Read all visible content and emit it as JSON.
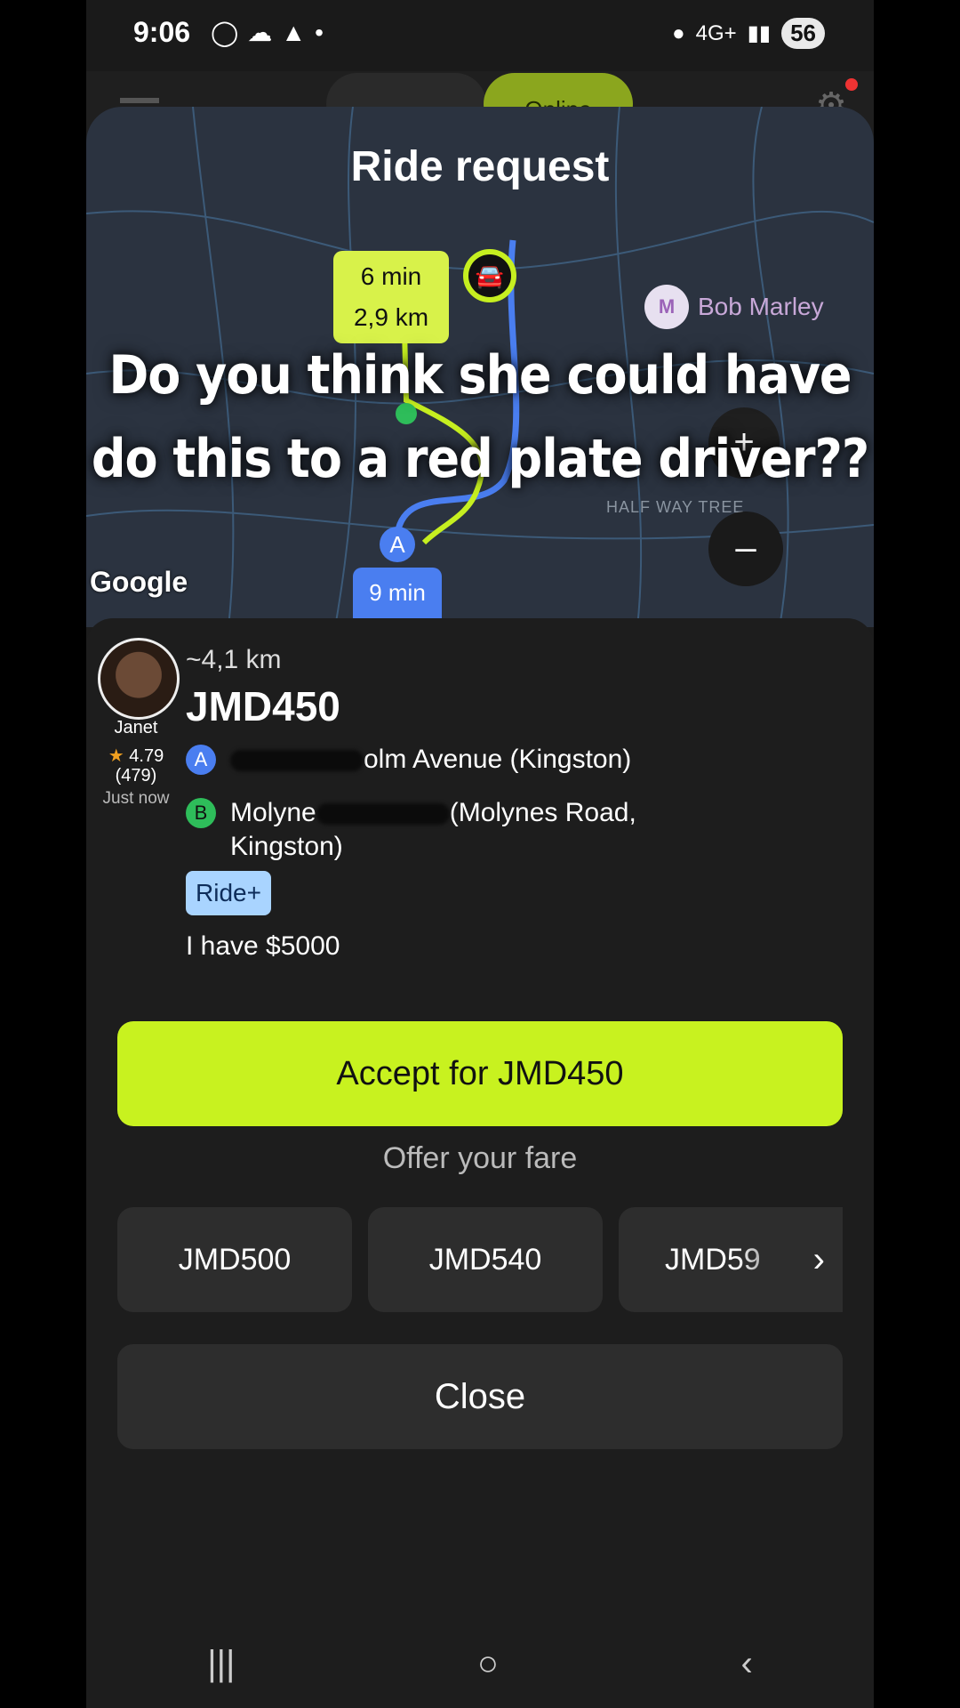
{
  "status_bar": {
    "time": "9:06",
    "network": "4G+",
    "battery": "56"
  },
  "app_bar": {
    "online_label": "Online"
  },
  "sheet": {
    "title": "Ride request",
    "map": {
      "eta_pickup": "6 min",
      "distance_pickup": "2,9 km",
      "poi_label": "Bob Marley",
      "area_label": "HALF WAY TREE",
      "eta_trip": "9 min",
      "pin_a": "A",
      "attribution": "Google",
      "zoom_in": "+",
      "zoom_out": "–"
    },
    "overlay_caption": "Do you think she could have do this to a red plate driver??",
    "passenger": {
      "name": "Janet",
      "rating": "4.79",
      "rating_count": "(479)",
      "requested": "Just now"
    },
    "trip": {
      "distance": "~4,1 km",
      "price": "JMD450",
      "pickup_badge": "A",
      "pickup_address": "olm Avenue (Kingston)",
      "dropoff_badge": "B",
      "dropoff_prefix": "Molyne",
      "dropoff_address": "(Molynes Road, Kingston)",
      "service": "Ride+",
      "note": "I have $5000"
    },
    "accept_label": "Accept for JMD450",
    "offer_label": "Offer your fare",
    "fares": [
      "JMD500",
      "JMD540",
      "JMD59"
    ],
    "close_label": "Close"
  },
  "colors": {
    "accent": "#c8f21f",
    "route_blue": "#4a7ef0",
    "route_green": "#c6ef20",
    "background": "#1d1d1d"
  }
}
